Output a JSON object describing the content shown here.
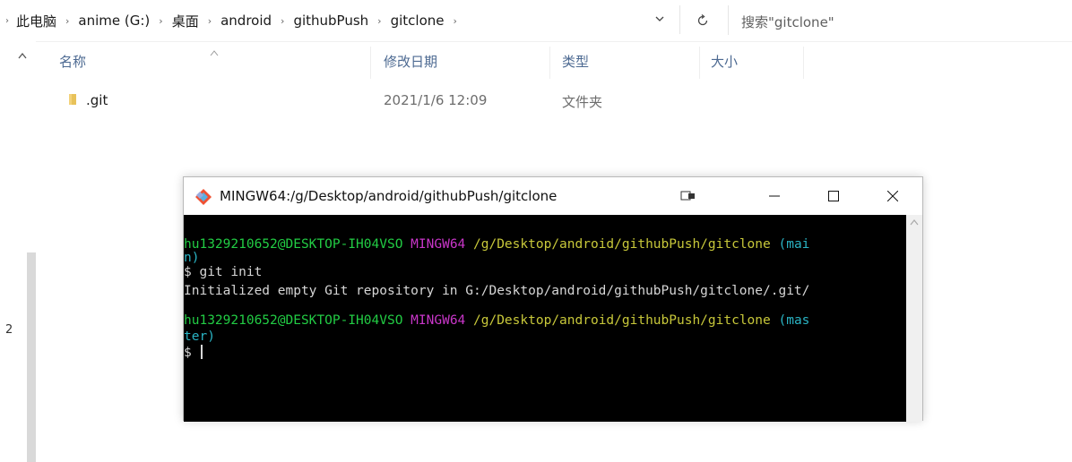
{
  "address_bar": {
    "crumbs": [
      "此电脑",
      "anime (G:)",
      "桌面",
      "android",
      "githubPush",
      "gitclone"
    ],
    "search_placeholder": "搜索\"gitclone\""
  },
  "columns": {
    "name": "名称",
    "modified": "修改日期",
    "type": "类型",
    "size": "大小"
  },
  "files": [
    {
      "name": ".git",
      "modified": "2021/1/6 12:09",
      "type": "文件夹",
      "size": ""
    }
  ],
  "nav_pane": {
    "cut_text": "2"
  },
  "terminal": {
    "title": "MINGW64:/g/Desktop/android/githubPush/gitclone",
    "lines": [
      {
        "user": "hu1329210652@DESKTOP-IH04VSO",
        "sys": "MINGW64",
        "path": "/g/Desktop/android/githubPush/gitclone",
        "branch_a": "(mai",
        "branch_b": "n)"
      },
      {
        "prompt": "$ git init"
      },
      {
        "output": "Initialized empty Git repository in G:/Desktop/android/githubPush/gitclone/.git/"
      },
      {
        "user": "hu1329210652@DESKTOP-IH04VSO",
        "sys": "MINGW64",
        "path": "/g/Desktop/android/githubPush/gitclone",
        "branch_a": "(mas",
        "branch_b": "ter)"
      },
      {
        "prompt": "$ "
      }
    ]
  },
  "colors": {
    "term_user": "#22cc44",
    "term_sys": "#c936c9",
    "term_path": "#c8c83a",
    "term_branch": "#2ab4c4",
    "term_bg": "#000000",
    "header_text": "#4d6a92",
    "folder": "#e8c25a"
  },
  "icons": [
    "chevron-right-icon",
    "chevron-down-icon",
    "refresh-icon",
    "folder-icon",
    "git-bash-icon",
    "minimize-icon",
    "maximize-icon",
    "close-icon",
    "sort-up-icon"
  ]
}
